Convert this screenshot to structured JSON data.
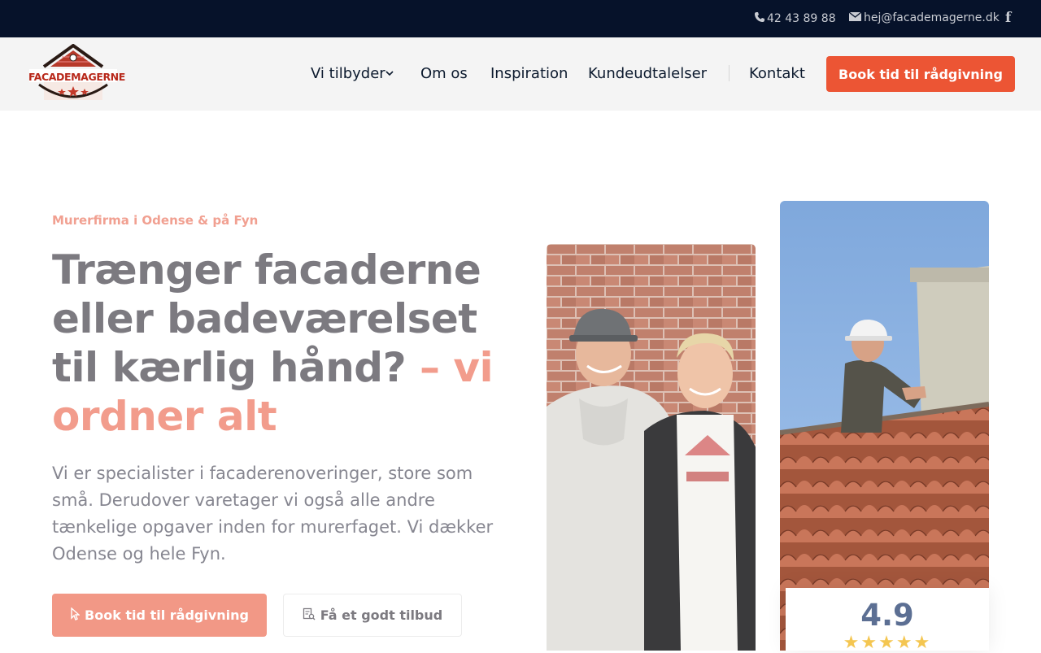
{
  "topbar": {
    "phone": "42 43 89 88",
    "email": "hej@facademagerne.dk",
    "facebook_icon": "facebook-icon"
  },
  "header": {
    "logo_text": "FACADEMAGERNE",
    "nav": {
      "offer": "Vi tilbyder",
      "about": "Om os",
      "inspiration": "Inspiration",
      "testimonials": "Kundeudtalelser",
      "contact": "Kontakt"
    },
    "cta": "Book tid til rådgivning"
  },
  "hero": {
    "eyebrow": "Murerfirma i Odense & på Fyn",
    "headline": "Trænger facaderne eller badeværelset til kærlig hånd?",
    "headline_accent": "– vi ordner alt",
    "lead": "Vi er specialister i facaderenoveringer, store som små. Derudover varetager vi også alle andre tænkelige opgaver inden for murerfaget. Vi dækker Odense og hele Fyn.",
    "btn_primary": "Book tid til rådgivning",
    "btn_secondary": "Få et godt tilbud"
  },
  "rating": {
    "score": "4.9",
    "stars": 5
  },
  "colors": {
    "topbar": "#06122a",
    "accent": "#ec5534",
    "accent_soft": "#f29c8c",
    "headline": "#7c7a80",
    "star": "#f4c651"
  }
}
